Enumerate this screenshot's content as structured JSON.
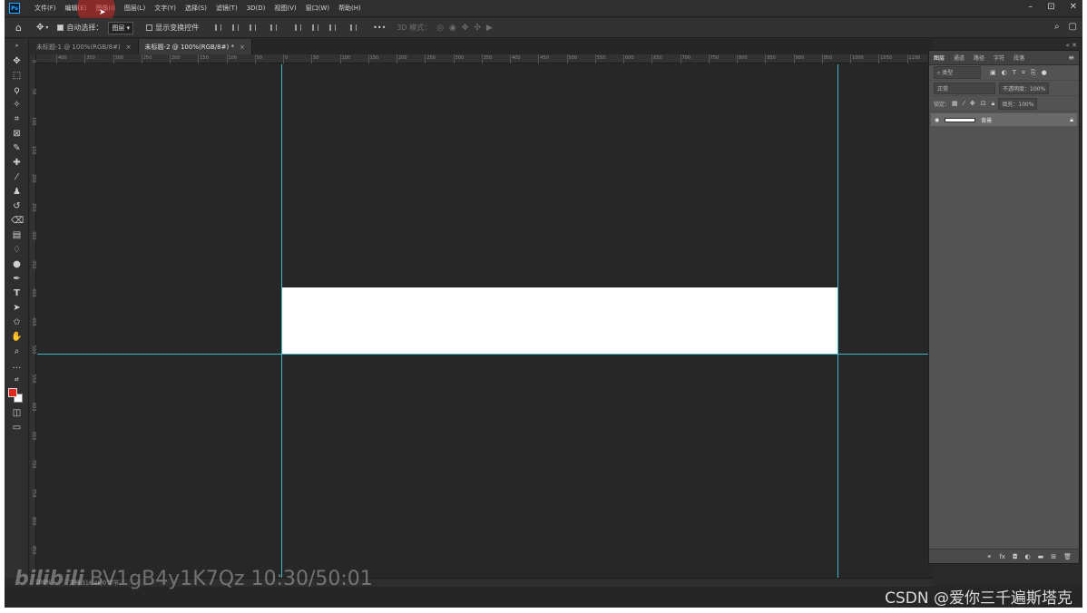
{
  "app": {
    "logo": "Ps"
  },
  "menu": [
    "文件(F)",
    "编辑(E)",
    "图像(I)",
    "图层(L)",
    "文字(Y)",
    "选择(S)",
    "滤镜(T)",
    "3D(D)",
    "视图(V)",
    "窗口(W)",
    "帮助(H)"
  ],
  "window_controls": {
    "minimize": "–",
    "restore": "⊡",
    "close": "✕"
  },
  "options_bar": {
    "auto_select_label": "自动选择：",
    "auto_select_value": "图层",
    "show_transform_label": "显示变换控件",
    "more": "•••",
    "mode_3d_label": "3D 模式："
  },
  "documents": [
    {
      "title": "未标题-1 @ 100%(RGB/8#)",
      "close": "×"
    },
    {
      "title": "未标题-2 @ 100%(RGB/8#) *",
      "close": "×"
    }
  ],
  "ruler_top": [
    "400",
    "350",
    "300",
    "250",
    "200",
    "150",
    "100",
    "50",
    "0",
    "50",
    "100",
    "150",
    "200",
    "250",
    "300",
    "350",
    "400",
    "450",
    "500",
    "550",
    "600",
    "650",
    "700",
    "750",
    "800",
    "850",
    "900",
    "950",
    "1000",
    "1050",
    "1100"
  ],
  "ruler_left": [
    "0",
    "50",
    "100",
    "150",
    "200",
    "250",
    "300",
    "350",
    "400",
    "450",
    "500",
    "550",
    "600",
    "650",
    "700",
    "750",
    "800",
    "850"
  ],
  "status": {
    "zoom": "100%",
    "doc": "文档:316.4K/0 字节"
  },
  "layers_panel": {
    "tabs": [
      "图层",
      "通道",
      "路径",
      "字符",
      "段落"
    ],
    "search": "类型",
    "blend_mode": "正常",
    "opacity": "不透明度：100%",
    "lock_label": "锁定：",
    "fill": "填充：100%",
    "layer": {
      "name": "背景"
    }
  },
  "watermarks": {
    "video_logo": "bilibili",
    "video": "BV1gB4y1K7Qz 10:30/50:01",
    "csdn": "CSDN @爱你三千遍斯塔克"
  }
}
